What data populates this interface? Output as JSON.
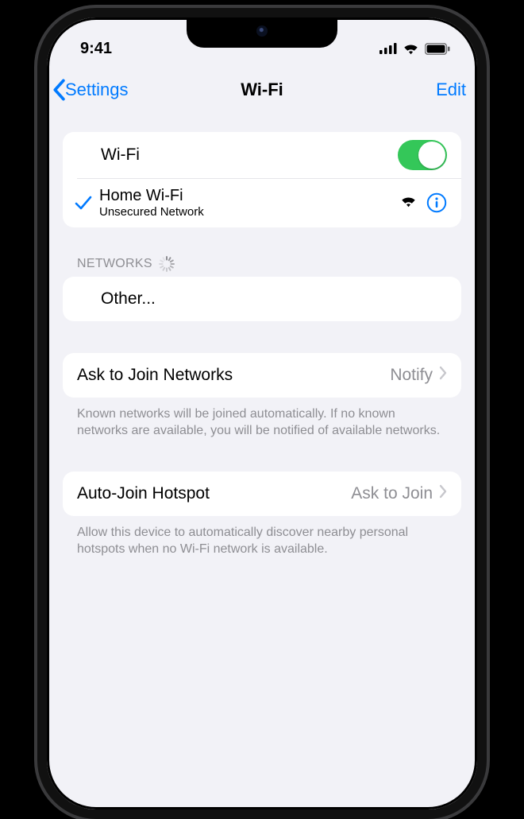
{
  "status_bar": {
    "time": "9:41"
  },
  "nav": {
    "back_label": "Settings",
    "title": "Wi-Fi",
    "edit_label": "Edit"
  },
  "wifi": {
    "toggle_label": "Wi-Fi",
    "connected": {
      "name": "Home Wi-Fi",
      "subtitle": "Unsecured Network"
    }
  },
  "sections": {
    "networks_header": "NETWORKS",
    "other_label": "Other..."
  },
  "ask_join": {
    "label": "Ask to Join Networks",
    "value": "Notify",
    "footer": "Known networks will be joined automatically. If no known networks are available, you will be notified of available networks."
  },
  "auto_hotspot": {
    "label": "Auto-Join Hotspot",
    "value": "Ask to Join",
    "footer": "Allow this device to automatically discover nearby personal hotspots when no Wi-Fi network is available."
  },
  "colors": {
    "tint": "#007aff",
    "toggle_on": "#34c759"
  }
}
